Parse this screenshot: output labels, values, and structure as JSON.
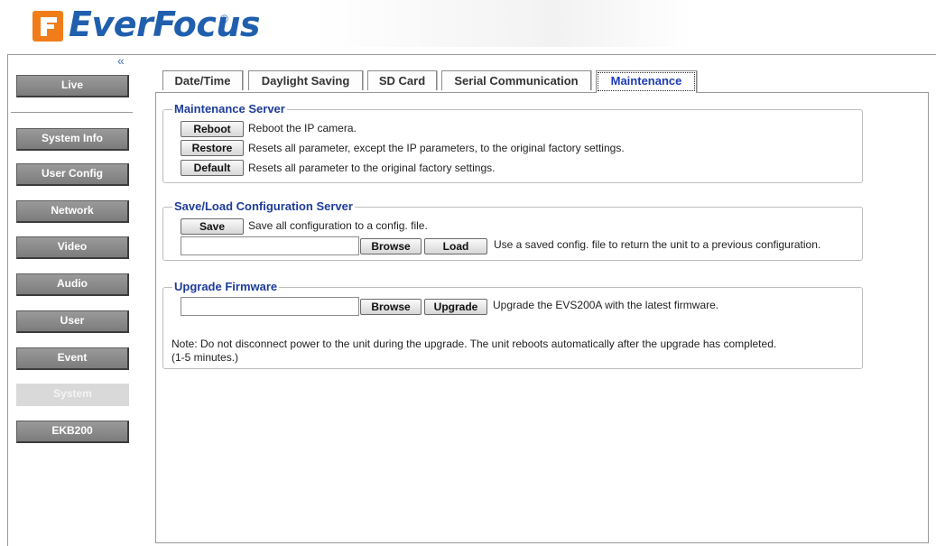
{
  "header": {
    "brand": "EverFocus",
    "registered": "®"
  },
  "sidebar": {
    "collapse_glyph": "«",
    "items": [
      {
        "label": "Live"
      },
      {
        "label": "System Info"
      },
      {
        "label": "User Config"
      },
      {
        "label": "Network"
      },
      {
        "label": "Video"
      },
      {
        "label": "Audio"
      },
      {
        "label": "User"
      },
      {
        "label": "Event"
      },
      {
        "label": "System"
      },
      {
        "label": "EKB200"
      }
    ],
    "active": "System"
  },
  "tabs": [
    {
      "label": "Date/Time"
    },
    {
      "label": "Daylight Saving"
    },
    {
      "label": "SD Card"
    },
    {
      "label": "Serial Communication"
    },
    {
      "label": "Maintenance"
    }
  ],
  "active_tab": "Maintenance",
  "maintenance": {
    "title": "Maintenance Server",
    "reboot_label": "Reboot",
    "reboot_desc": "Reboot the IP camera.",
    "restore_label": "Restore",
    "restore_desc": "Resets all parameter, except the IP parameters, to the original factory settings.",
    "default_label": "Default",
    "default_desc": "Resets all parameter to the original factory settings."
  },
  "config": {
    "title": "Save/Load Configuration Server",
    "save_label": "Save",
    "save_desc": "Save all configuration to a config. file.",
    "file_value": "",
    "browse_label": "Browse",
    "load_label": "Load",
    "load_desc": "Use a saved config. file to return the unit to a previous configuration."
  },
  "firmware": {
    "title": "Upgrade Firmware",
    "file_value": "",
    "browse_label": "Browse",
    "upgrade_label": "Upgrade",
    "upgrade_desc": "Upgrade the EVS200A with the latest firmware.",
    "note_line1": "Note: Do not disconnect power to the unit during the upgrade. The unit reboots automatically after the upgrade has completed.",
    "note_line2": "(1-5 minutes.)"
  },
  "colors": {
    "brand_blue": "#1f5fae",
    "logo_orange": "#f07d1a",
    "legend_blue": "#1e3c9a",
    "active_tab_text": "#1e3cb4"
  }
}
